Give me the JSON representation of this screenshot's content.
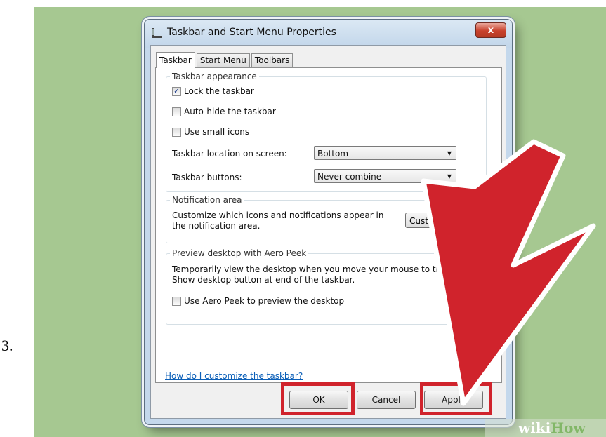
{
  "step": {
    "number": "3."
  },
  "window": {
    "title": "Taskbar and Start Menu Properties",
    "close_glyph": "x"
  },
  "tabs": [
    {
      "label": "Taskbar"
    },
    {
      "label": "Start Menu"
    },
    {
      "label": "Toolbars"
    }
  ],
  "appearance": {
    "title": "Taskbar appearance",
    "lock": {
      "label": "Lock the taskbar",
      "checked": true
    },
    "autohide": {
      "label": "Auto-hide the taskbar",
      "checked": false
    },
    "small_icons": {
      "label": "Use small icons",
      "checked": false
    },
    "location": {
      "label": "Taskbar location on screen:",
      "value": "Bottom"
    },
    "buttons": {
      "label": "Taskbar buttons:",
      "value": "Never combine"
    }
  },
  "notification": {
    "title": "Notification area",
    "description": "Customize which icons and notifications appear in the notification area.",
    "button": "Customize..."
  },
  "aero_peek": {
    "title": "Preview desktop with Aero Peek",
    "description": "Temporarily view the desktop when you move your mouse to the Show desktop button at end of the taskbar.",
    "checkbox": {
      "label": "Use Aero Peek to preview the desktop",
      "checked": false
    }
  },
  "help_link": "How do I customize the taskbar?",
  "buttons": {
    "ok": "OK",
    "cancel": "Cancel",
    "apply": "Apply"
  },
  "colors": {
    "highlight": "#d0232c",
    "arrow": "#d0232c",
    "background": "#a6c891"
  },
  "watermark": {
    "part1": "wiki",
    "part2": "How"
  }
}
